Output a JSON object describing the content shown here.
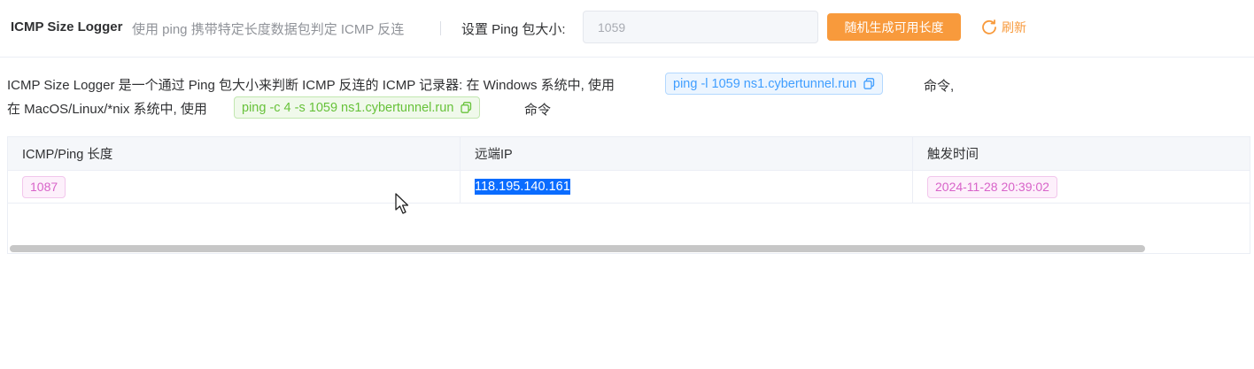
{
  "header": {
    "title": "ICMP Size Logger",
    "subtitle": "使用 ping 携带特定长度数据包判定 ICMP 反连",
    "size_label": "设置 Ping 包大小:",
    "size_value": "1059",
    "generate_button": "随机生成可用长度",
    "refresh_button": "刷新"
  },
  "description": {
    "line1_text": "ICMP Size Logger 是一个通过 Ping 包大小来判断 ICMP 反连的 ICMP 记录器: 在 Windows 系统中, 使用",
    "windows_command": "ping -l 1059 ns1.cybertunnel.run",
    "line1_suffix": "命令,",
    "line2_text": "在 MacOS/Linux/*nix 系统中, 使用",
    "unix_command": "ping -c 4 -s 1059 ns1.cybertunnel.run",
    "line2_suffix": "命令"
  },
  "table": {
    "columns": [
      "ICMP/Ping 长度",
      "远端IP",
      "触发时间"
    ],
    "rows": [
      {
        "length": "1087",
        "ip": "118.195.140.161",
        "time": "2024-11-28 20:39:02"
      }
    ]
  },
  "colors": {
    "accent": "#f89a3c",
    "windows_tag": "#409eff",
    "unix_tag": "#67c23a",
    "pill": "#d863c9",
    "selection": "#0a6cff"
  },
  "icons": {
    "refresh": "refresh-icon",
    "copy": "copy-icon",
    "cursor": "mouse-pointer-icon"
  }
}
